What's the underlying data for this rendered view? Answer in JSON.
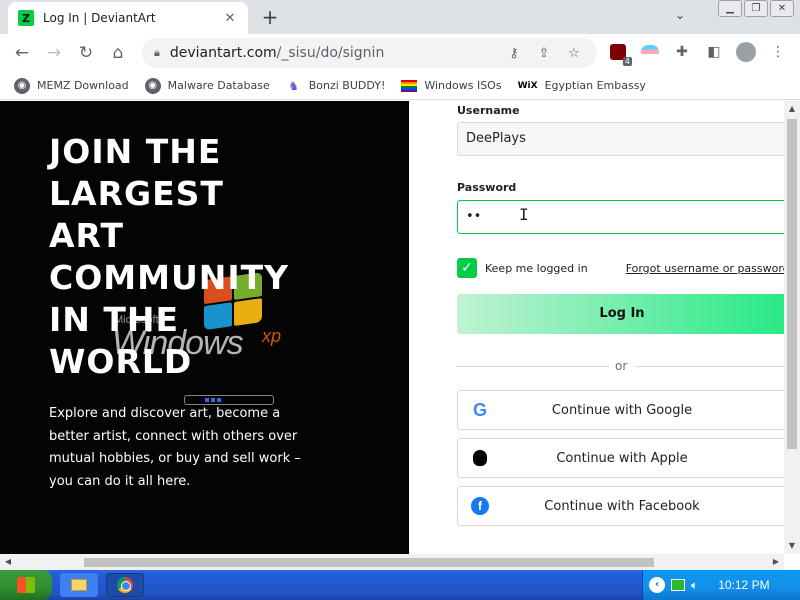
{
  "browser": {
    "tab": {
      "title": "Log In | DeviantArt",
      "favicon": "deviantart-icon",
      "close": "✕"
    },
    "new_tab": "+",
    "url_host": "deviantart.com",
    "url_path": "/_sisu/do/signin",
    "extension_badge": "4"
  },
  "bookmarks": [
    {
      "label": "MEMZ Download",
      "icon": "globe-icon"
    },
    {
      "label": "Malware Database",
      "icon": "globe-icon"
    },
    {
      "label": "Bonzi BUDDY!",
      "icon": "bonzi-icon"
    },
    {
      "label": "Windows ISOs",
      "icon": "rainbow-flag-icon"
    },
    {
      "label": "Egyptian Embassy",
      "icon": "wix-icon",
      "icon_text": "WiX"
    }
  ],
  "hero": {
    "headline": "JOIN THE\nLARGEST\nART\nCOMMUNITY\nIN THE\nWORLD",
    "subtext": "Explore and discover art, become a better artist, connect with others over mutual hobbies, or buy and sell work – you can do it all here.",
    "background_logo": {
      "microsoft": "Microsoft",
      "windows": "Windows",
      "xp": "xp"
    }
  },
  "form": {
    "username_label": "Username",
    "username_value": "DeePlays",
    "password_label": "Password",
    "password_value": "••",
    "remember_label": "Keep me logged in",
    "remember_checked": true,
    "forgot_label": "Forgot username or password?",
    "login_label": "Log In",
    "or_label": "or",
    "google_label": "Continue with Google",
    "apple_label": "Continue with Apple",
    "facebook_label": "Continue with Facebook"
  },
  "colors": {
    "accent": "#05cc47",
    "hero_bg": "#040404",
    "facebook": "#1877f2",
    "google": "#4285f4"
  },
  "taskbar": {
    "clock": "10:12 PM"
  }
}
